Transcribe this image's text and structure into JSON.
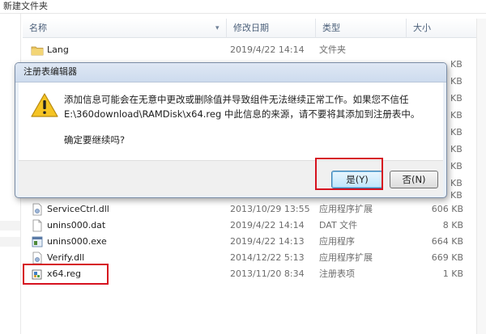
{
  "window": {
    "title": "新建文件夹"
  },
  "columns": {
    "name": "名称",
    "date": "修改日期",
    "type": "类型",
    "size": "大小"
  },
  "files": [
    {
      "name": "Lang",
      "date": "2019/4/22 14:14",
      "type": "文件夹",
      "size": "",
      "icon": "folder-icon"
    },
    {
      "name": "ServiceCtrl.dll",
      "date": "2013/10/29 13:55",
      "type": "应用程序扩展",
      "size": "606 KB",
      "icon": "dll-file-icon"
    },
    {
      "name": "unins000.dat",
      "date": "2019/4/22 14:14",
      "type": "DAT 文件",
      "size": "8 KB",
      "icon": "generic-file-icon"
    },
    {
      "name": "unins000.exe",
      "date": "2019/4/22 14:13",
      "type": "应用程序",
      "size": "664 KB",
      "icon": "exe-file-icon"
    },
    {
      "name": "Verify.dll",
      "date": "2014/12/22 5:13",
      "type": "应用程序扩展",
      "size": "669 KB",
      "icon": "dll-file-icon"
    },
    {
      "name": "x64.reg",
      "date": "2013/11/20 8:34",
      "type": "注册表项",
      "size": "1 KB",
      "icon": "reg-file-icon"
    }
  ],
  "hidden_size_stubs": [
    "KB",
    "KB",
    "KB",
    "KB",
    "KB",
    "KB",
    "KB",
    "KB",
    "KB"
  ],
  "dialog": {
    "title": "注册表编辑器",
    "line1": "添加信息可能会在无意中更改或删除值并导致组件无法继续正常工作。如果您不信任",
    "line2": "E:\\360download\\RAMDisk\\x64.reg 中此信息的来源，请不要将其添加到注册表中。",
    "line3": "确定要继续吗?",
    "yes_label": "是(Y)",
    "no_label": "否(N)"
  },
  "colors": {
    "highlight": "#d6121f",
    "dialog_bg": "#eaf0f7",
    "header_text": "#4c607a"
  }
}
